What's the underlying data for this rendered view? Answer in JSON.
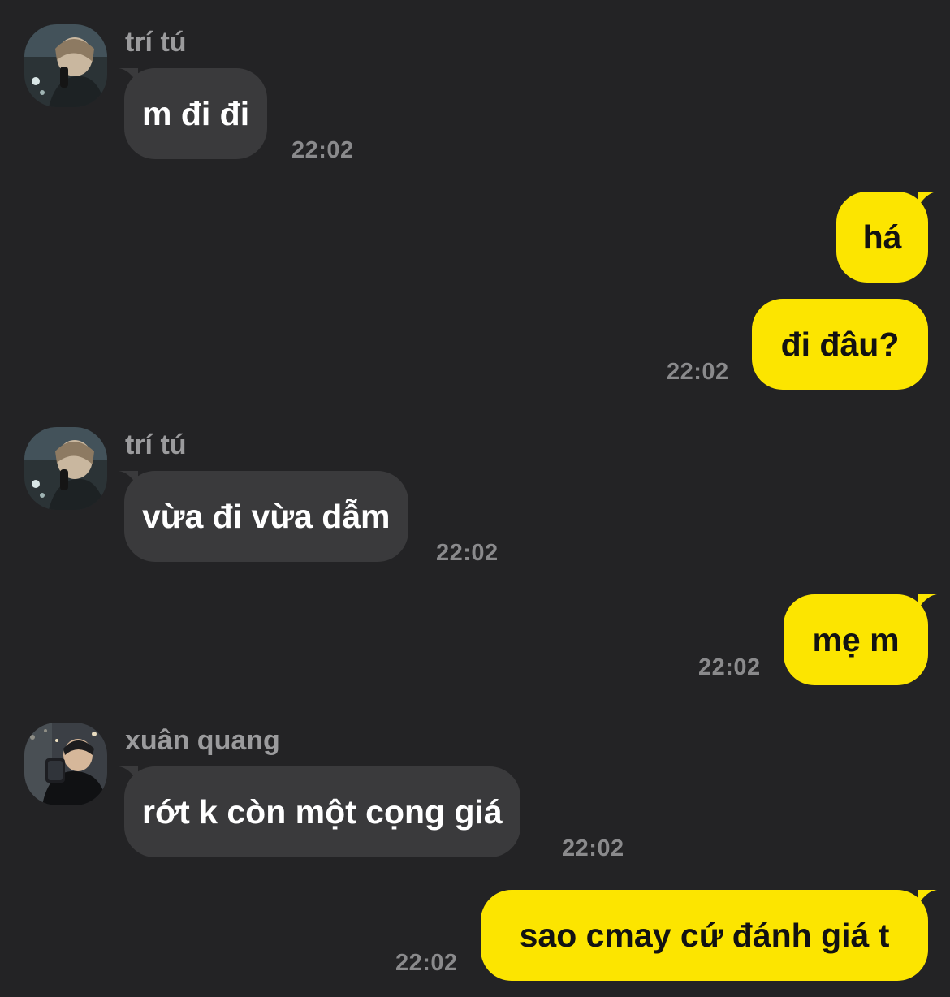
{
  "colors": {
    "background": "#232325",
    "incoming_bubble": "#3a3a3c",
    "outgoing_bubble": "#fce500",
    "incoming_text": "#ffffff",
    "outgoing_text": "#121212",
    "name_text": "#9b9b9d",
    "time_text": "#8a8a8c"
  },
  "messages": [
    {
      "direction": "incoming",
      "sender": "trí tú",
      "avatar_icon": "user-photo-avatar",
      "text": "m đi đi",
      "time": "22:02"
    },
    {
      "direction": "outgoing",
      "text": "há"
    },
    {
      "direction": "outgoing",
      "text": "đi đâu?",
      "time": "22:02"
    },
    {
      "direction": "incoming",
      "sender": "trí tú",
      "avatar_icon": "user-photo-avatar",
      "text": "vừa đi vừa dẫm",
      "time": "22:02"
    },
    {
      "direction": "outgoing",
      "text": "mẹ m",
      "time": "22:02"
    },
    {
      "direction": "incoming",
      "sender": "xuân quang",
      "avatar_icon": "user-photo-avatar",
      "text": "rớt k còn một cọng giá",
      "time": "22:02"
    },
    {
      "direction": "outgoing",
      "text": "sao cmay cứ đánh giá t",
      "time": "22:02"
    }
  ]
}
